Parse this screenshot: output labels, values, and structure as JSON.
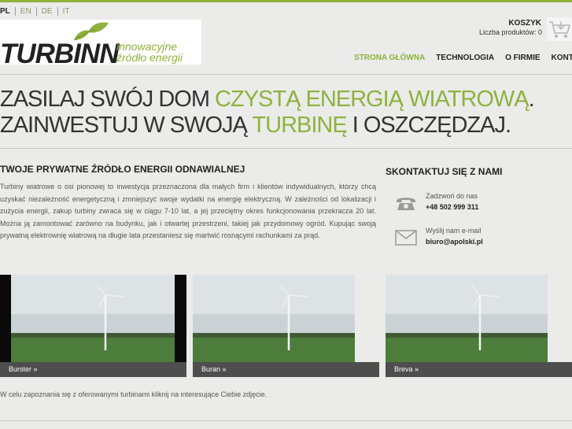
{
  "languages": [
    "PL",
    "EN",
    "DE",
    "IT"
  ],
  "logo": {
    "brand": "TURBINN",
    "tagline_line1": "innowacyjne",
    "tagline_line2": "źródło energii"
  },
  "cart": {
    "title": "KOSZYK",
    "count_text": "Liczba produktów: 0",
    "icon": "cart-icon"
  },
  "nav": [
    "STRONA GŁÓWNA",
    "TECHNOLOGIA",
    "O FIRMIE",
    "KONTAKT"
  ],
  "hero": {
    "line1_a": "ZASILAJ SWÓJ DOM ",
    "line1_b": "CZYSTĄ ENERGIĄ WIATROWĄ",
    "line1_c": ".",
    "line2_a": "ZAINWESTUJ W SWOJĄ ",
    "line2_b": "TURBINĘ",
    "line2_c": " I OSZCZĘDZAJ."
  },
  "about": {
    "title": "TWOJE PRYWATNE ŹRÓDŁO ENERGII ODNAWIALNEJ",
    "text": "Turbiny wiatrowe o osi pionowej to inwestycja przeznaczona dla małych firm i klientów indywidualnych, którzy chcą uzyskać niezależność energetyczną i zmniejszyć swoje wydatki na energię elektryczną. W zależności od lokalizacji i zużycia energii, zakup turbiny zwraca się w ciągu 7-10 lat, a jej przeciętny okres funkcjonowania przekracza 20 lat. Można ją zamontować zarówno na budynku, jak i otwartej przestrzeni, takiej jak przydomowy ogród. Kupując swoją prywatną elektrownię wiatrową na długie lata przestaniesz się martwić rosnącymi rachunkami za prąd."
  },
  "contact": {
    "title": "SKONTAKTUJ SIĘ Z NAMI",
    "phone_label": "Zadzwoń do nas",
    "phone": "+48 502 999 311",
    "email_label": "Wyślij nam e-mail",
    "email": "biuro@apolski.pl"
  },
  "products": [
    {
      "caption": "Burster »"
    },
    {
      "caption": "Buran »"
    },
    {
      "caption": "Breva »"
    }
  ],
  "footer_note": "W celu zapoznania się z oferowanymi turbinami kliknij na interesujące Ciebie zdjęcie.",
  "colors": {
    "accent": "#8fb23e",
    "background": "#ebebea",
    "caption_bar": "#4e4e4e"
  }
}
